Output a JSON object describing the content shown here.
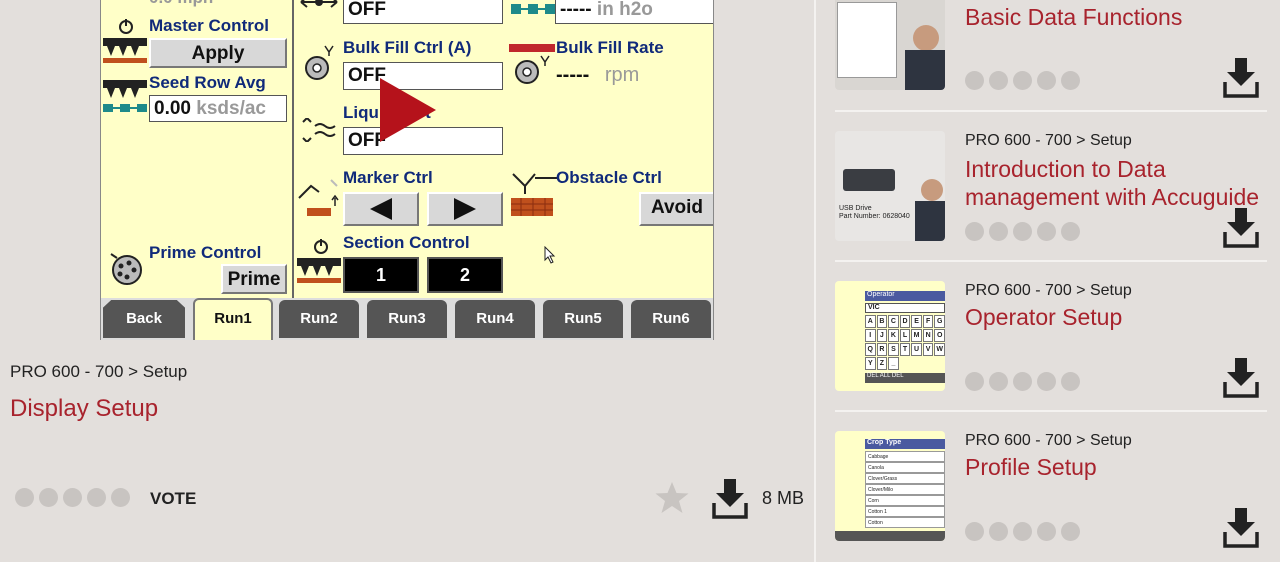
{
  "player": {
    "top_partial_text": "0.0 mph",
    "master_control": {
      "label": "Master Control",
      "button": "Apply"
    },
    "seed_row_avg": {
      "label": "Seed Row Avg",
      "value": "0.00",
      "unit": "ksds/ac"
    },
    "prime_control": {
      "label": "Prime Control",
      "button": "Prime"
    },
    "top_box_left": "OFF",
    "top_box_right": {
      "value": "-----",
      "unit": "in h2o"
    },
    "bulk_fill_ctrl": {
      "label": "Bulk Fill Ctrl (A)",
      "value": "OFF"
    },
    "bulk_fill_rate": {
      "label": "Bulk Fill Rate",
      "value": "-----",
      "unit": "rpm"
    },
    "liquid": {
      "label": "Liquid Fert",
      "value": "OFF"
    },
    "marker_ctrl": {
      "label": "Marker Ctrl"
    },
    "obstacle_ctrl": {
      "label": "Obstacle Ctrl",
      "button": "Avoid"
    },
    "section_control": {
      "label": "Section Control",
      "buttons": [
        "1",
        "2"
      ]
    },
    "tabs": [
      "Back",
      "Run1",
      "Run2",
      "Run3",
      "Run4",
      "Run5",
      "Run6"
    ]
  },
  "video": {
    "breadcrumb": "PRO 600 - 700 > Setup",
    "title": "Display Setup",
    "vote_label": "VOTE",
    "size": "8 MB"
  },
  "list": [
    {
      "crumb": "",
      "title": "Basic Data Functions"
    },
    {
      "crumb": "PRO 600 - 700 > Setup",
      "title": "Introduction to Data management with Accuguide"
    },
    {
      "crumb": "PRO 600 - 700 > Setup",
      "title": "Operator Setup"
    },
    {
      "crumb": "PRO 600 - 700 > Setup",
      "title": "Profile Setup"
    }
  ],
  "thumbs": {
    "item2_text": "USB Drive\nPart Number: 0628040",
    "item3_header": "Operator",
    "item3_value": "VIC",
    "item3_keys": [
      "A",
      "B",
      "C",
      "D",
      "E",
      "F",
      "G",
      "I",
      "J",
      "K",
      "L",
      "M",
      "N",
      "O",
      "Q",
      "R",
      "S",
      "T",
      "U",
      "V",
      "W",
      "Y",
      "Z",
      "_"
    ],
    "item3_bottom": "DEL ALL  DEL",
    "item4_header": "Crop Type",
    "item4_rows": [
      "Cabbage",
      "Canola",
      "Clover/Grass",
      "Clover/Milo",
      "Corn",
      "Cotton 1",
      "Cotton"
    ]
  },
  "colors": {
    "accent": "#a8232d",
    "screen_bg": "#ffffc8",
    "label_blue": "#102a7a"
  },
  "icons": [
    "play-icon",
    "star-icon",
    "download-icon"
  ]
}
